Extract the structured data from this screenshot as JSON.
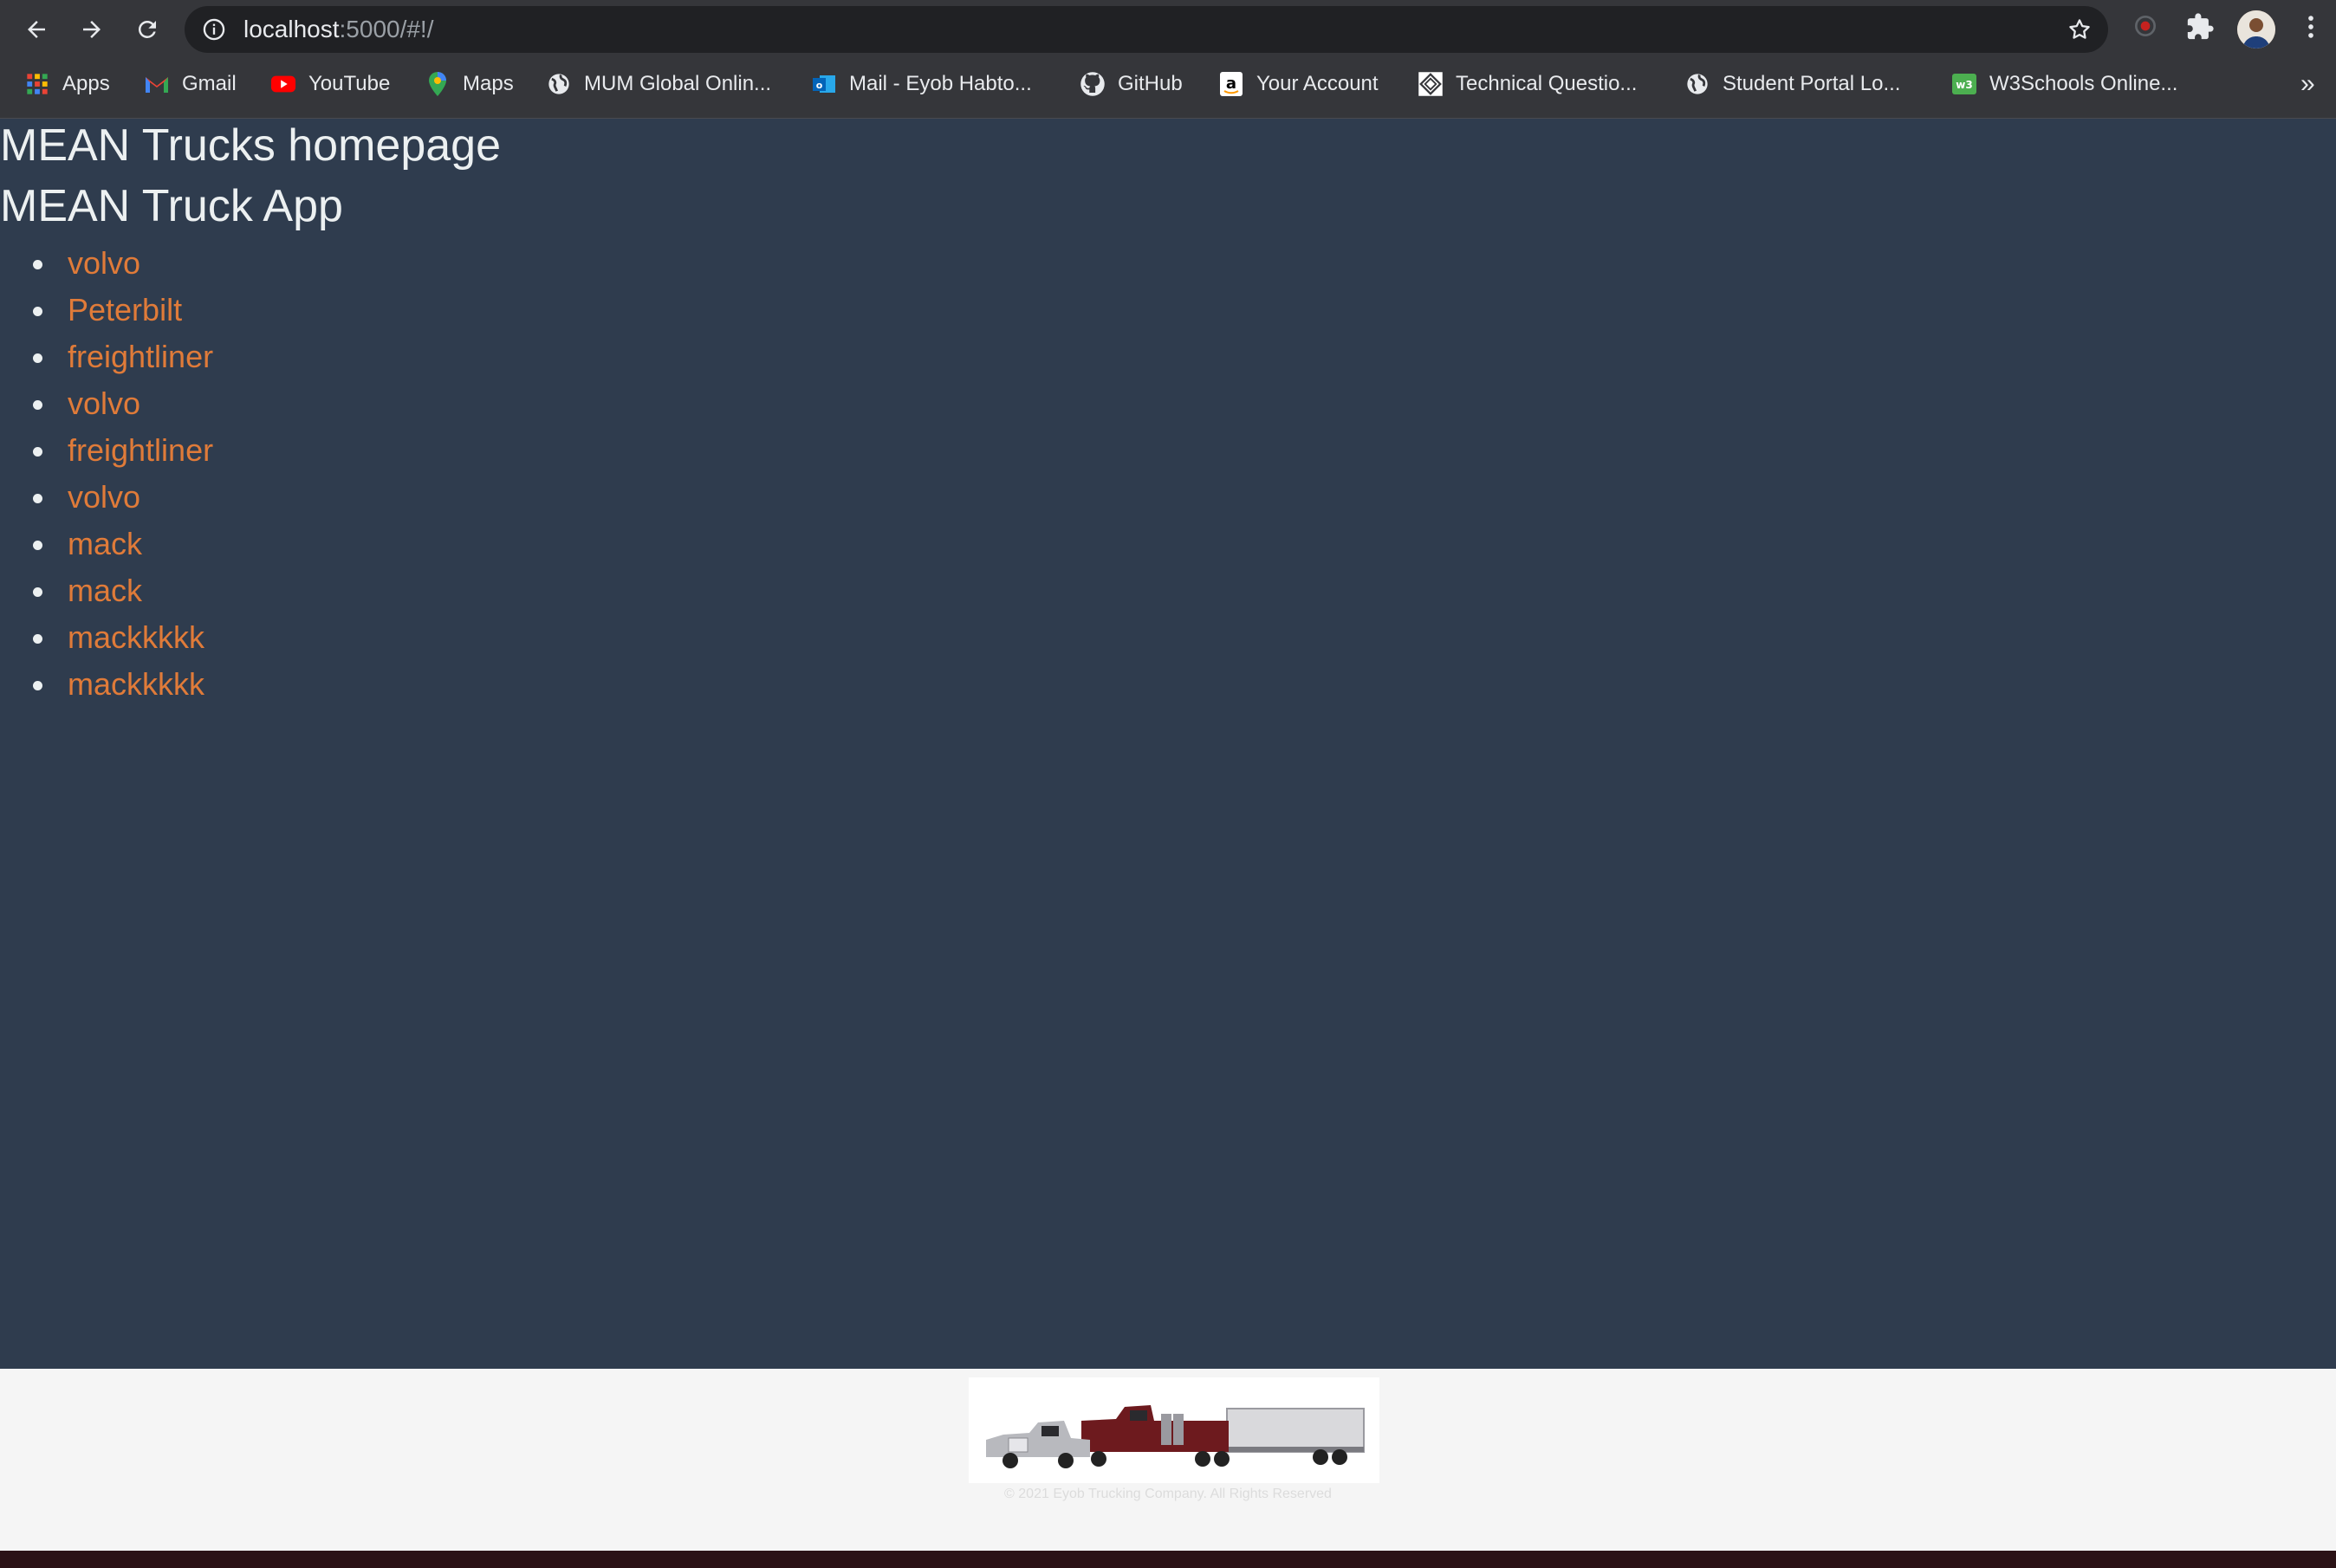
{
  "browser": {
    "url_host": "localhost",
    "url_rest": ":5000/#!/",
    "bookmarks": [
      {
        "label": "Apps",
        "icon": "apps-grid-icon"
      },
      {
        "label": "Gmail",
        "icon": "gmail-icon"
      },
      {
        "label": "YouTube",
        "icon": "youtube-icon"
      },
      {
        "label": "Maps",
        "icon": "maps-pin-icon"
      },
      {
        "label": "MUM Global Onlin...",
        "icon": "globe-icon"
      },
      {
        "label": "Mail - Eyob Habto...",
        "icon": "outlook-icon"
      },
      {
        "label": "GitHub",
        "icon": "github-icon"
      },
      {
        "label": "Your Account",
        "icon": "amazon-icon"
      },
      {
        "label": "Technical Questio...",
        "icon": "diamond-logo-icon"
      },
      {
        "label": "Student Portal Lo...",
        "icon": "globe-icon"
      },
      {
        "label": "W3Schools Online...",
        "icon": "w3schools-icon"
      }
    ],
    "more_label": "»"
  },
  "page": {
    "title": "MEAN Trucks homepage",
    "app_heading": "MEAN Truck App",
    "trucks": [
      "volvo",
      "Peterbilt",
      "freightliner",
      "volvo",
      "freightliner",
      "volvo",
      "mack",
      "mack",
      "mackkkkk",
      "mackkkkk"
    ],
    "footer_copyright": "© 2021 Eyob Trucking Company. All Rights Reserved"
  },
  "colors": {
    "page_background": "#2f3c4e",
    "heading_text": "#ecf0f1",
    "link_accent": "#e07b39",
    "footer_background": "#f5f5f5"
  }
}
